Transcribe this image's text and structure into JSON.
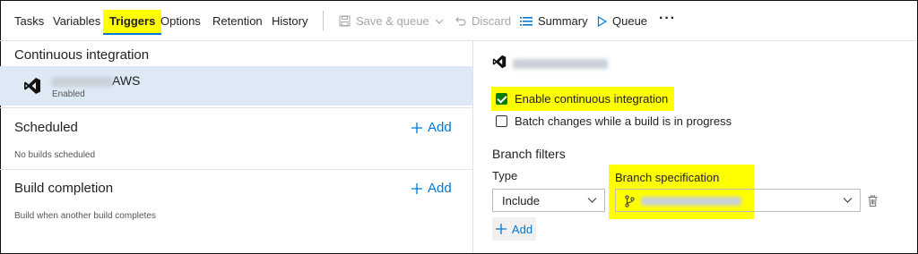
{
  "tabs": [
    {
      "label": "Tasks"
    },
    {
      "label": "Variables"
    },
    {
      "label": "Triggers"
    },
    {
      "label": "Options"
    },
    {
      "label": "Retention"
    },
    {
      "label": "History"
    }
  ],
  "active_tab": "Triggers",
  "toolbar": {
    "save_queue": "Save & queue",
    "discard": "Discard",
    "summary": "Summary",
    "queue": "Queue",
    "more": "···"
  },
  "left": {
    "ci_title": "Continuous integration",
    "ci_item": {
      "name_suffix": "AWS",
      "status": "Enabled"
    },
    "scheduled": {
      "title": "Scheduled",
      "add": "Add",
      "note": "No builds scheduled"
    },
    "build_completion": {
      "title": "Build completion",
      "add": "Add",
      "note": "Build when another build completes"
    }
  },
  "right": {
    "enable_ci": {
      "label": "Enable continuous integration",
      "checked": true
    },
    "batch": {
      "label": "Batch changes while a build is in progress",
      "checked": false
    },
    "branch_filters": {
      "title": "Branch filters",
      "type_label": "Type",
      "type_value": "Include",
      "spec_label": "Branch specification",
      "add": "Add"
    }
  },
  "colors": {
    "accent": "#0078d4",
    "highlight": "#ffff00",
    "selected_row": "#dde9f5",
    "vs_purple": "#68217a"
  }
}
